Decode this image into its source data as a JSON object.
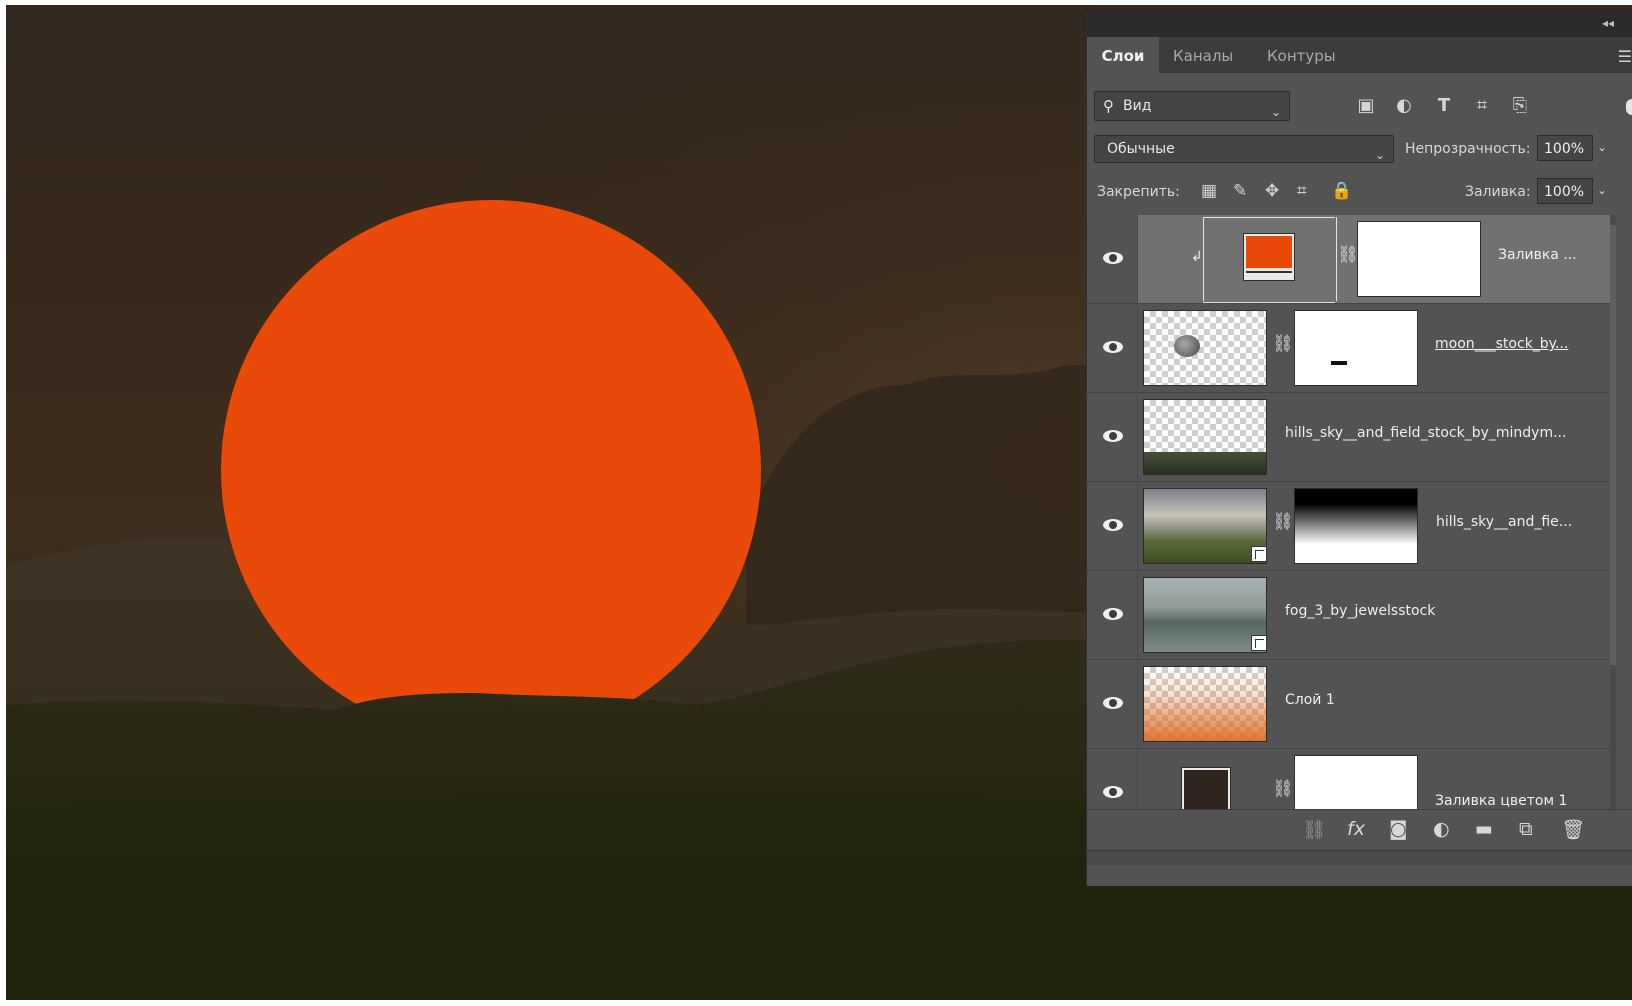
{
  "panel": {
    "tabs": [
      "Слои",
      "Каналы",
      "Контуры"
    ],
    "filter": {
      "label": "Вид",
      "icons": [
        "image-filter-icon",
        "adjustment-filter-icon",
        "type-filter-icon",
        "shape-filter-icon",
        "smart-object-filter-icon"
      ]
    },
    "blend": {
      "mode": "Обычные",
      "opacity_label": "Непрозрачность:",
      "opacity": "100%"
    },
    "lock": {
      "label": "Закрепить:",
      "fill_label": "Заливка:",
      "fill": "100%"
    },
    "layers": [
      {
        "name": "Заливка ...",
        "selected": true,
        "thumb_color": "#e94a0a",
        "clipped": true
      },
      {
        "name": "moon___stock_by...",
        "selected": false
      },
      {
        "name": "hills_sky__and_field_stock_by_mindym...",
        "selected": false
      },
      {
        "name": "hills_sky__and_fie...",
        "selected": false
      },
      {
        "name": "fog_3_by_jewelsstock",
        "selected": false
      },
      {
        "name": "Слой 1",
        "selected": false
      },
      {
        "name": "Заливка цветом 1",
        "selected": false,
        "thumb_color": "#2e241d"
      }
    ],
    "bottom_icons": [
      "link-layers-icon",
      "fx-icon",
      "add-mask-icon",
      "new-adjustment-icon",
      "new-group-icon",
      "new-layer-icon",
      "delete-layer-icon"
    ]
  },
  "canvas": {
    "sun_color": "#e94a0a"
  }
}
